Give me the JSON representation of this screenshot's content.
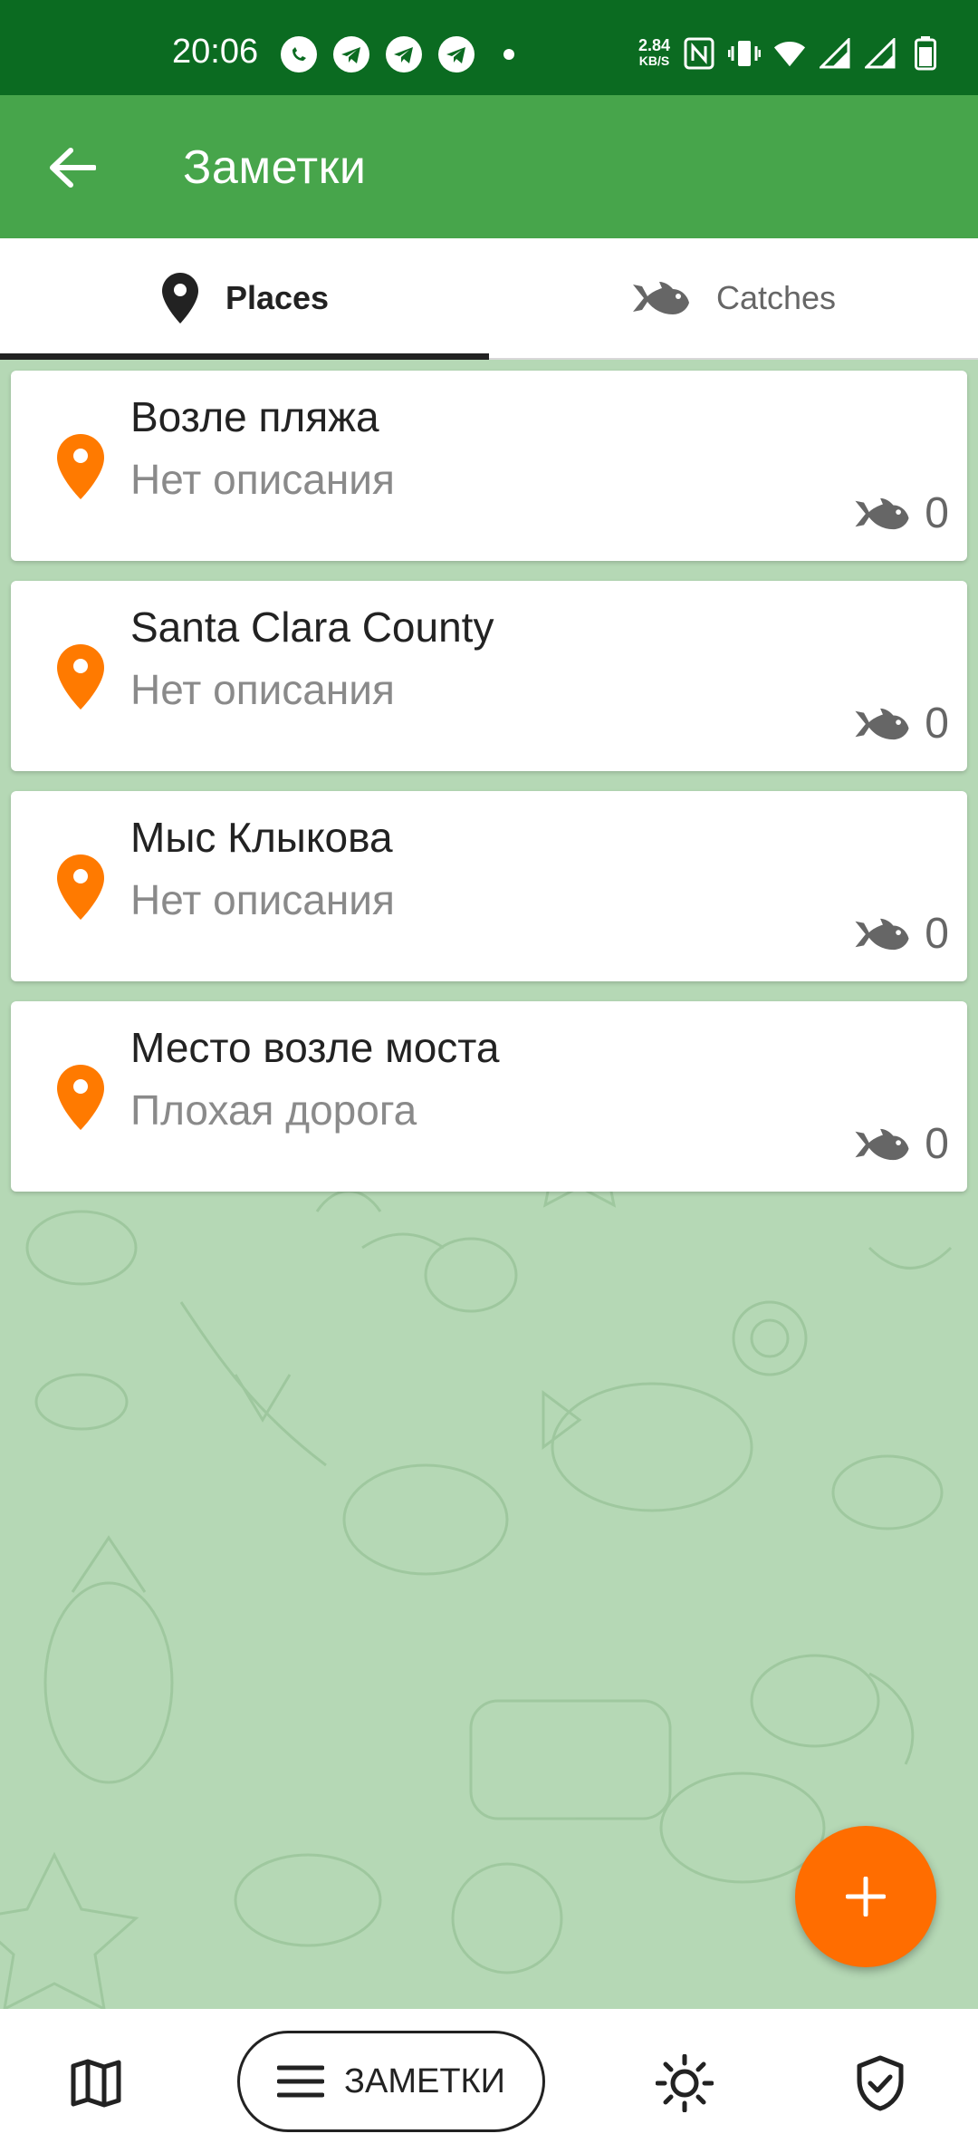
{
  "status_bar": {
    "time": "20:06",
    "net_speed_value": "2.84",
    "net_speed_unit": "KB/S",
    "icons": [
      "whatsapp-icon",
      "telegram-icon",
      "telegram-icon",
      "telegram-icon",
      "dot-icon",
      "nfc-icon",
      "vibrate-icon",
      "wifi-icon",
      "signal-icon",
      "signal-icon",
      "battery-icon"
    ]
  },
  "app_bar": {
    "title": "Заметки"
  },
  "tabs": [
    {
      "label": "Places",
      "icon": "pin-icon",
      "active": true
    },
    {
      "label": "Catches",
      "icon": "fish-icon",
      "active": false
    }
  ],
  "places": [
    {
      "title": "Возле пляжа",
      "description": "Нет описания",
      "catch_count": "0"
    },
    {
      "title": "Santa Clara County",
      "description": "Нет описания",
      "catch_count": "0"
    },
    {
      "title": "Мыс Клыкова",
      "description": "Нет описания",
      "catch_count": "0"
    },
    {
      "title": "Место возле моста",
      "description": "Плохая дорога",
      "catch_count": "0"
    }
  ],
  "bottom_nav": {
    "notes_label": "ЗАМЕТКИ",
    "items": [
      "map-icon",
      "menu-icon",
      "weather-icon",
      "shield-icon"
    ]
  },
  "colors": {
    "status_bar": "#0b6b21",
    "app_bar": "#47a54b",
    "background": "#b5d8b5",
    "accent": "#ff6d00"
  }
}
